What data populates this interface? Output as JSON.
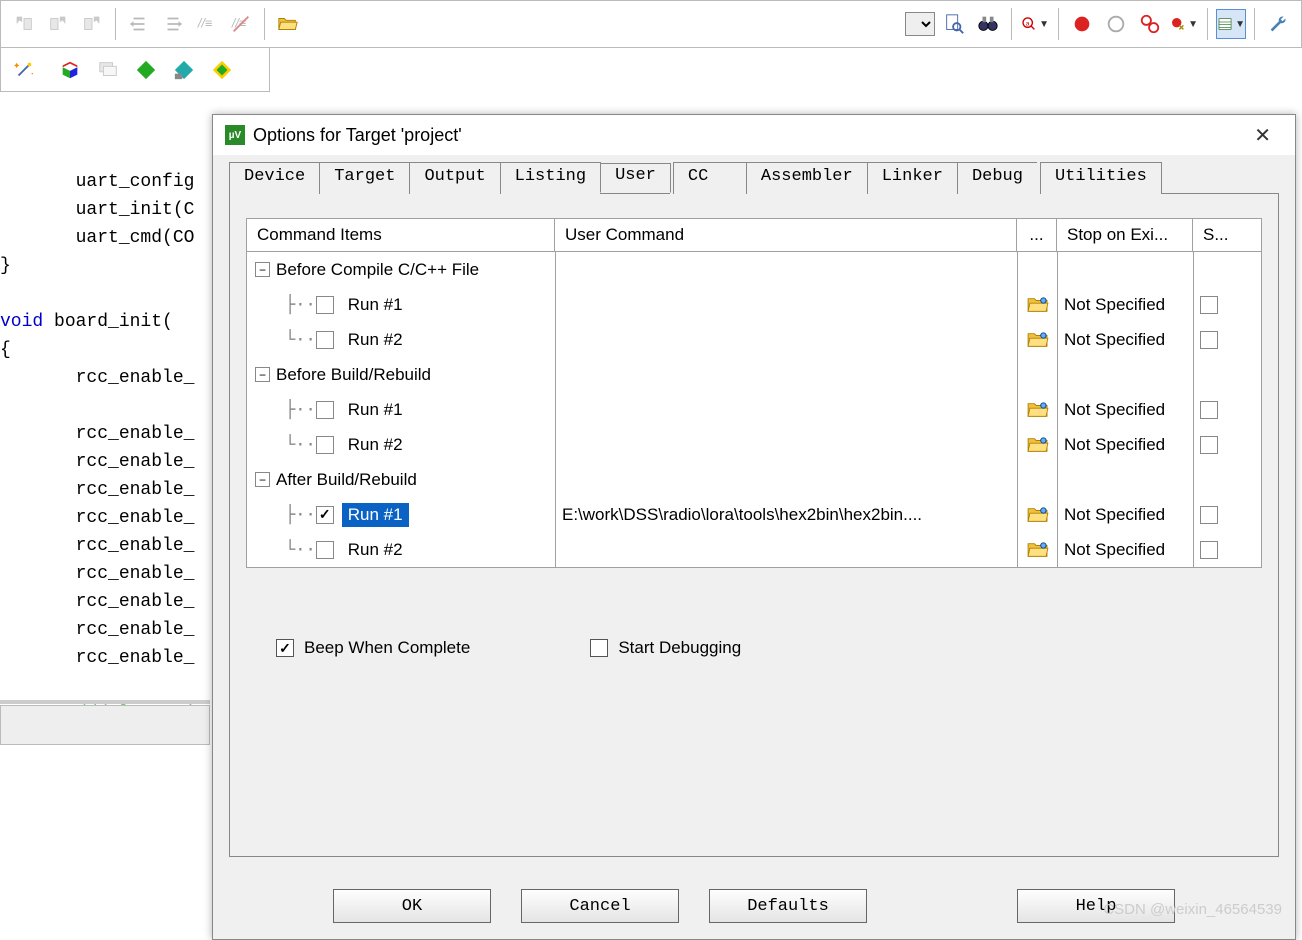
{
  "toolbar1": {
    "icons": [
      "nav-back",
      "nav-fwd",
      "nav-up",
      "indent-l",
      "indent-r",
      "comment",
      "uncomment",
      "folder-open",
      "search-doc",
      "find",
      "find-start",
      "rec-red",
      "rec-grey",
      "link",
      "build",
      "list-view",
      "wrench"
    ]
  },
  "toolbar2": {
    "icons": [
      "magic",
      "cube",
      "stacks",
      "diamond-g",
      "diamond-b",
      "diamond-y"
    ]
  },
  "code": {
    "l1": "       uart_config",
    "l2": "       uart_init(C",
    "l3": "       uart_cmd(CO",
    "l4": "}",
    "l5_kw": "void",
    "l5_b": " board_init(",
    "l6": "{",
    "l7": "       rcc_enable_",
    "l8": "",
    "l9": "       rcc_enable_",
    "l10": "       rcc_enable_",
    "l11": "       rcc_enable_",
    "l12": "       rcc_enable_",
    "l13": "       rcc_enable_",
    "l14": "       rcc_enable_",
    "l15": "       rcc_enable_",
    "l16": "       rcc_enable_",
    "l17": "       rcc_enable_",
    "l18": "",
    "l19": "       //delav ms("
  },
  "dialog": {
    "title": "Options for Target 'project'",
    "tabs": [
      "Device",
      "Target",
      "Output",
      "Listing",
      "User",
      "CC",
      "Assembler",
      "Linker",
      "Debug",
      "Utilities"
    ],
    "active_tab": 4,
    "columns": {
      "cmd": "Command Items",
      "usercmd": "User Command",
      "browse": "...",
      "stop": "Stop on Exi...",
      "s": "S..."
    },
    "groups": [
      {
        "name": "Before Compile C/C++ File",
        "rows": [
          {
            "label": "Run #1",
            "checked": false,
            "cmd": "",
            "stop": "Not Specified",
            "s": false
          },
          {
            "label": "Run #2",
            "checked": false,
            "cmd": "",
            "stop": "Not Specified",
            "s": false
          }
        ]
      },
      {
        "name": "Before Build/Rebuild",
        "rows": [
          {
            "label": "Run #1",
            "checked": false,
            "cmd": "",
            "stop": "Not Specified",
            "s": false
          },
          {
            "label": "Run #2",
            "checked": false,
            "cmd": "",
            "stop": "Not Specified",
            "s": false
          }
        ]
      },
      {
        "name": "After Build/Rebuild",
        "rows": [
          {
            "label": "Run #1",
            "checked": true,
            "cmd": "E:\\work\\DSS\\radio\\lora\\tools\\hex2bin\\hex2bin....",
            "stop": "Not Specified",
            "s": false,
            "selected": true
          },
          {
            "label": "Run #2",
            "checked": false,
            "cmd": "",
            "stop": "Not Specified",
            "s": false
          }
        ]
      }
    ],
    "beep": {
      "label": "Beep When Complete",
      "checked": true
    },
    "startdbg": {
      "label": "Start Debugging",
      "checked": false
    },
    "buttons": {
      "ok": "OK",
      "cancel": "Cancel",
      "defaults": "Defaults",
      "help": "Help"
    }
  },
  "watermark": "CSDN @weixin_46564539"
}
